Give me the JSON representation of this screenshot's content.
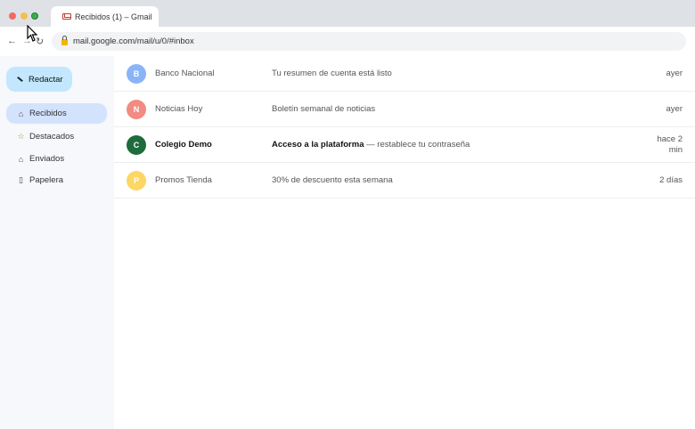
{
  "browser": {
    "tab_title": "Recibidos (1) – Gmail",
    "url": "mail.google.com/mail/u/0/#inbox",
    "nav": {
      "back": "←",
      "forward": "→",
      "reload": "↻"
    }
  },
  "sidebar": {
    "compose_label": "Redactar",
    "items": [
      {
        "label": "Recibidos",
        "icon": "inbox-icon",
        "glyph": "⌂",
        "active": true
      },
      {
        "label": "Destacados",
        "icon": "star-icon",
        "glyph": "☆",
        "active": false
      },
      {
        "label": "Enviados",
        "icon": "sent-icon",
        "glyph": "⌂",
        "active": false
      },
      {
        "label": "Papelera",
        "icon": "trash-icon",
        "glyph": "▯",
        "active": false
      }
    ]
  },
  "emails": [
    {
      "initial": "B",
      "avatar_color": "#8ab4f8",
      "sender": "Banco Nacional",
      "subject_bold": "",
      "subject": "Tu resumen de cuenta está listo",
      "date": "ayer",
      "unread": false
    },
    {
      "initial": "N",
      "avatar_color": "#f28b82",
      "sender": "Noticias Hoy",
      "subject_bold": "",
      "subject": "Boletín semanal de noticias",
      "date": "ayer",
      "unread": false
    },
    {
      "initial": "C",
      "avatar_color": "#1e6b3c",
      "sender": "Colegio Demo",
      "subject_bold": "Acceso a la plataforma",
      "subject": " — restablece tu contraseña",
      "date_line1": "hace 2",
      "date_line2": "min",
      "unread": true
    },
    {
      "initial": "P",
      "avatar_color": "#fdd663",
      "sender": "Promos Tienda",
      "subject_bold": "",
      "subject": "30% de descuento esta semana",
      "date": "2 días",
      "unread": false
    }
  ]
}
